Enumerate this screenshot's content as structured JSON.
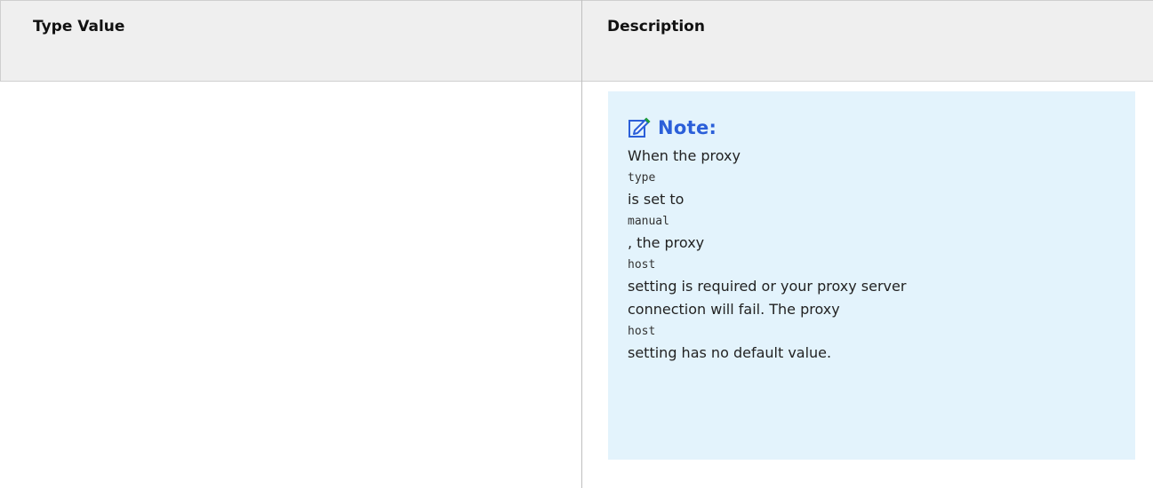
{
  "table": {
    "headers": {
      "type_value": "Type Value",
      "description": "Description"
    }
  },
  "note": {
    "icon": "edit-note-icon",
    "title": "Note:",
    "lines": [
      {
        "text": "When the proxy",
        "kind": "text"
      },
      {
        "text": "type",
        "kind": "code"
      },
      {
        "text": "is set to",
        "kind": "text"
      },
      {
        "text": "manual",
        "kind": "code"
      },
      {
        "text": ", the proxy",
        "kind": "text"
      },
      {
        "text": "host",
        "kind": "code"
      },
      {
        "text": "setting is required or your proxy server",
        "kind": "text"
      },
      {
        "text": "connection will fail. The proxy",
        "kind": "text"
      },
      {
        "text": "host",
        "kind": "code"
      },
      {
        "text": "setting has no default value.",
        "kind": "text"
      }
    ]
  },
  "colors": {
    "header_bg": "#efefef",
    "note_bg": "#e3f3fc",
    "note_title": "#2b5fd9",
    "icon_accent": "#1f9d3a"
  }
}
